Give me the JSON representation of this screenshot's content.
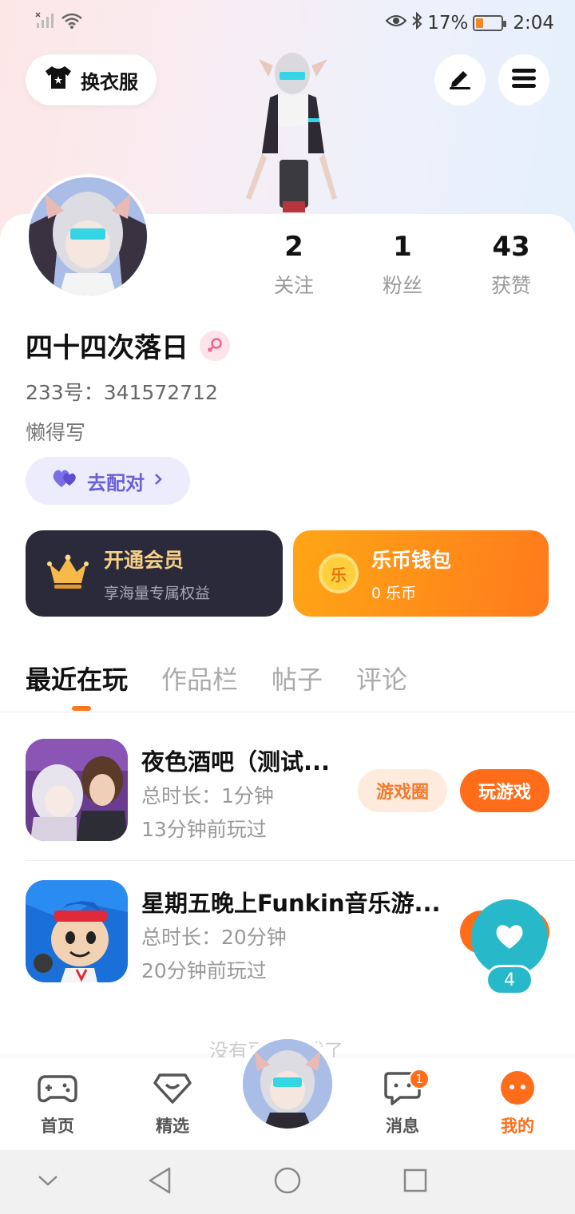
{
  "status_bar": {
    "battery": "17%",
    "time": "2:04"
  },
  "header": {
    "outfit_label": "换衣服"
  },
  "profile": {
    "stats": [
      {
        "value": "2",
        "label": "关注"
      },
      {
        "value": "1",
        "label": "粉丝"
      },
      {
        "value": "43",
        "label": "获赞"
      }
    ],
    "username": "四十四次落日",
    "gender_icon": "female",
    "uid": "233号：341572712",
    "bio": "懒得写",
    "pair_label": "去配对"
  },
  "cards": {
    "vip_title": "开通会员",
    "vip_sub": "享海量专属权益",
    "wallet_title": "乐币钱包",
    "wallet_sub": "0 乐币",
    "coin_glyph": "乐"
  },
  "tabs": [
    {
      "label": "最近在玩",
      "active": true
    },
    {
      "label": "作品栏",
      "active": false
    },
    {
      "label": "帖子",
      "active": false
    },
    {
      "label": "评论",
      "active": false
    }
  ],
  "games": [
    {
      "title": "夜色酒吧（测试...",
      "duration": "总时长：1分钟",
      "last_played": "13分钟前玩过",
      "circle_label": "游戏圈",
      "play_label": "玩游戏"
    },
    {
      "title": "星期五晚上Funkin音乐游...",
      "duration": "总时长：20分钟",
      "last_played": "20分钟前玩过"
    }
  ],
  "end_text": "没有更多游戏了",
  "like_float": {
    "count": "4"
  },
  "bottom_nav": [
    {
      "label": "首页",
      "icon": "gamepad-icon"
    },
    {
      "label": "精选",
      "icon": "heart-badge-icon"
    },
    {
      "label": "消息",
      "icon": "chat-icon",
      "badge": "1"
    },
    {
      "label": "我的",
      "icon": "smile-icon",
      "active": true
    }
  ],
  "colors": {
    "accent": "#ff7a1c",
    "pair": "#6a5fd8",
    "vip_bg": "#2b2a3b",
    "vip_text": "#f5cf86",
    "like": "#27b9c9"
  }
}
